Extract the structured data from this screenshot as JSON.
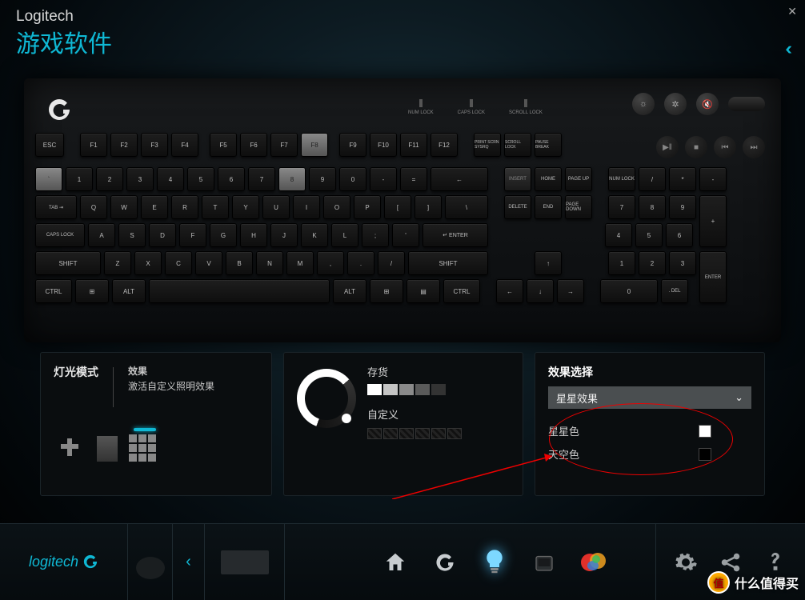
{
  "header": {
    "brand": "Logitech",
    "subtitle": "游戏软件",
    "close": "✕",
    "back": "‹‹"
  },
  "kb": {
    "indicators": [
      "NUM LOCK",
      "CAPS LOCK",
      "SCROLL LOCK"
    ],
    "topright_icons": [
      "☼",
      "✲",
      "🔇"
    ],
    "media": [
      "▶‖",
      "■",
      "⏮",
      "⏭"
    ],
    "row0": [
      "ESC",
      "F1",
      "F2",
      "F3",
      "F4",
      "F5",
      "F6",
      "F7",
      "F8",
      "F9",
      "F10",
      "F11",
      "F12",
      "PRINT SCRN SYSRQ",
      "SCROLL LOCK",
      "PAUSE BREAK"
    ],
    "row1": [
      "`",
      "1",
      "2",
      "3",
      "4",
      "5",
      "6",
      "7",
      "8",
      "9",
      "0",
      "-",
      "=",
      "←",
      "INSERT",
      "HOME",
      "PAGE UP",
      "NUM LOCK",
      "/",
      "*",
      "-"
    ],
    "row2": [
      "TAB ⇥",
      "Q",
      "W",
      "E",
      "R",
      "T",
      "Y",
      "U",
      "I",
      "O",
      "P",
      "[",
      "]",
      "\\",
      "DELETE",
      "END",
      "PAGE DOWN",
      "7",
      "8",
      "9",
      "+"
    ],
    "row3": [
      "CAPS LOCK",
      "A",
      "S",
      "D",
      "F",
      "G",
      "H",
      "J",
      "K",
      "L",
      ";",
      "'",
      "↵ ENTER",
      "4",
      "5",
      "6"
    ],
    "row4": [
      "SHIFT",
      "Z",
      "X",
      "C",
      "V",
      "B",
      "N",
      "M",
      ",",
      ".",
      "/",
      "SHIFT",
      "↑",
      "1",
      "2",
      "3",
      "ENTER"
    ],
    "row5": [
      "CTRL",
      "⊞",
      "ALT",
      " ",
      "ALT",
      "⊞",
      "▤",
      "CTRL",
      "←",
      "↓",
      "→",
      "0",
      ". DEL"
    ]
  },
  "panel1": {
    "title": "灯光模式",
    "sub1": "效果",
    "sub2": "激活自定义照明效果"
  },
  "panel2": {
    "stock": "存货",
    "custom": "自定义",
    "swatches": [
      "#fff",
      "#c4c4c4",
      "#8a8a8a",
      "#5a5a5a",
      "#333"
    ]
  },
  "panel3": {
    "title": "效果选择",
    "dropdown": "星星效果",
    "row1": "星星色",
    "row2": "天空色",
    "c1": "#fff",
    "c2": "#000"
  },
  "bottom": {
    "brand": "logitech",
    "icons": [
      "home",
      "g",
      "bulb",
      "key",
      "heatmap"
    ],
    "right": [
      "gear",
      "share",
      "help"
    ]
  },
  "watermark": "什么值得买"
}
